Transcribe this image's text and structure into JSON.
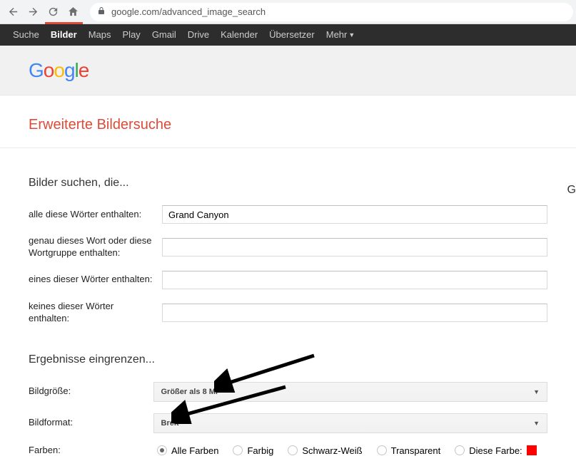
{
  "browser": {
    "url": "google.com/advanced_image_search"
  },
  "gbar": {
    "items": [
      "Suche",
      "Bilder",
      "Maps",
      "Play",
      "Gmail",
      "Drive",
      "Kalender",
      "Übersetzer",
      "Mehr"
    ]
  },
  "logo": {
    "letters": [
      "G",
      "o",
      "o",
      "g",
      "l",
      "e"
    ]
  },
  "page_title": "Erweiterte Bildersuche",
  "find": {
    "heading": "Bilder suchen, die...",
    "all_words_label": "alle diese Wörter enthalten:",
    "all_words_value": "Grand Canyon",
    "exact_label": "genau dieses Wort oder diese Wortgruppe enthalten:",
    "exact_value": "",
    "any_label": "eines dieser Wörter enthalten:",
    "any_value": "",
    "none_label": "keines dieser Wörter enthalten:",
    "none_value": ""
  },
  "narrow": {
    "heading": "Ergebnisse eingrenzen...",
    "size_label": "Bildgröße:",
    "size_value": "Größer als 8 MP",
    "aspect_label": "Bildformat:",
    "aspect_value": "Breit",
    "colors_label": "Farben:",
    "color_options": {
      "all": "Alle Farben",
      "full": "Farbig",
      "bw": "Schwarz-Weiß",
      "trans": "Transparent",
      "specific": "Diese Farbe:"
    }
  },
  "edge_letter": "G"
}
